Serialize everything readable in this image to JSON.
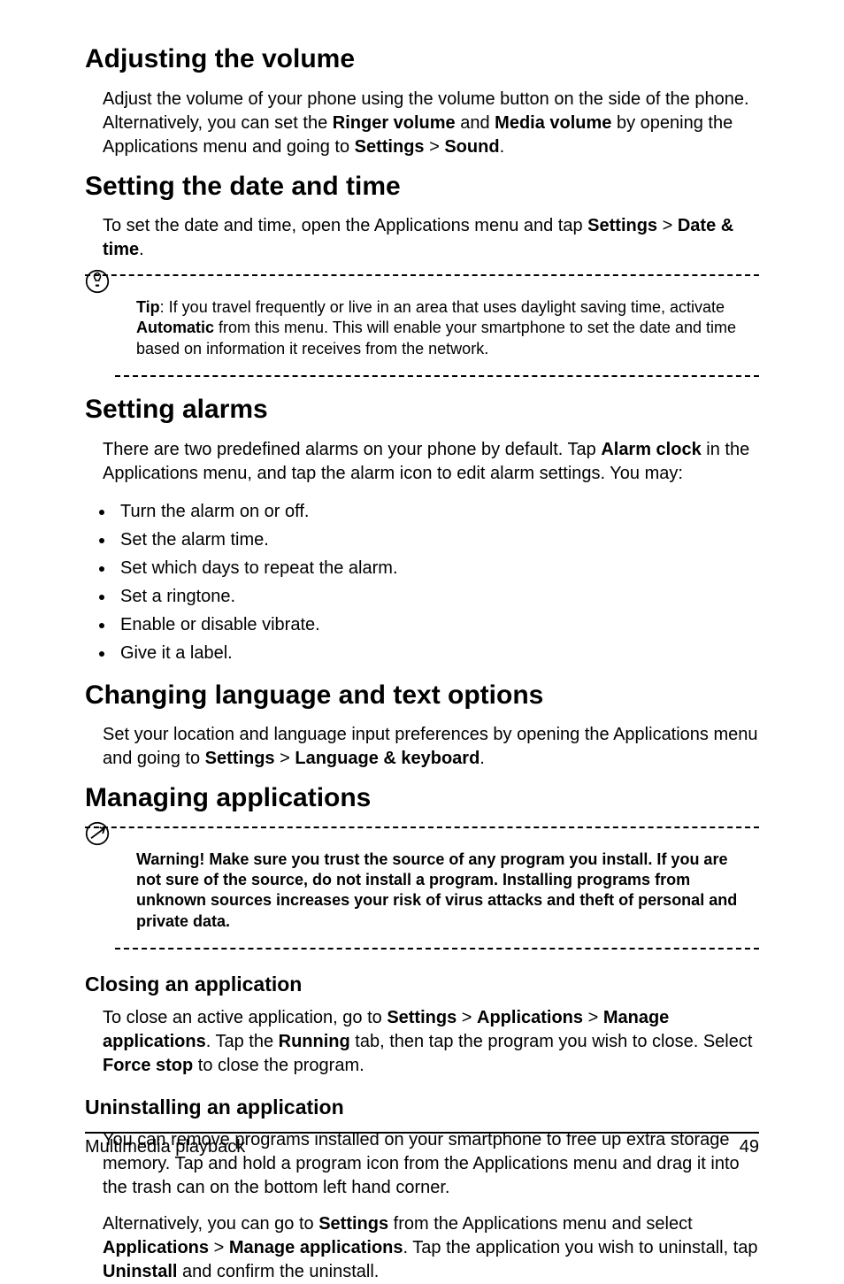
{
  "s1": {
    "h": "Adjusting the volume",
    "p_parts": [
      "Adjust the volume of your phone using the volume button on the side of the phone. Alternatively, you can set the ",
      "Ringer volume",
      " and ",
      "Media volume",
      " by opening the Applications menu and going to ",
      "Settings",
      " > ",
      "Sound",
      "."
    ]
  },
  "s2": {
    "h": "Setting the date and time",
    "p_parts": [
      "To set the date and time, open the Applications menu and tap ",
      "Settings",
      " > ",
      "Date & time",
      "."
    ],
    "tip_parts": [
      "Tip",
      ": If you travel frequently or live in an area that uses daylight saving time, activate ",
      "Automatic",
      " from this menu. This will enable your smartphone to set the date and time based on information it receives from the network."
    ]
  },
  "s3": {
    "h": "Setting alarms",
    "p_parts": [
      "There are two predefined alarms on your phone by default. Tap ",
      "Alarm clock",
      " in the Applications menu, and tap the alarm icon to edit alarm settings. You may:"
    ],
    "bullets": [
      "Turn the alarm on or off.",
      "Set the alarm time.",
      "Set which days to repeat the alarm.",
      "Set a ringtone.",
      "Enable or disable vibrate.",
      "Give it a label."
    ]
  },
  "s4": {
    "h": "Changing language and text options",
    "p_parts": [
      "Set your location and language input preferences by opening the Applications menu and going to ",
      "Settings",
      " > ",
      "Language & keyboard",
      "."
    ]
  },
  "s5": {
    "h": "Managing applications",
    "warn": "Warning! Make sure you trust the source of any program you install. If you are not sure of the source, do not install a program. Installing programs from unknown sources increases your risk of virus attacks and theft of personal and private data."
  },
  "s6": {
    "h": "Closing an application",
    "p_parts": [
      "To close an active application, go to ",
      "Settings",
      " > ",
      "Applications",
      " > ",
      "Manage applications",
      ". Tap the ",
      "Running",
      " tab, then tap the program you wish to close. Select ",
      "Force stop",
      " to close the program."
    ]
  },
  "s7": {
    "h": "Uninstalling an application",
    "p1": "You can remove programs installed on your smartphone to free up extra storage memory. Tap and hold a program icon from the Applications menu and drag it into the trash can on the bottom left hand corner.",
    "p2_parts": [
      "Alternatively, you can go to ",
      "Settings",
      " from the Applications menu and select ",
      "Applications",
      " > ",
      "Manage applications",
      ". Tap the application you wish to uninstall, tap ",
      "Uninstall",
      " and confirm the uninstall."
    ]
  },
  "footer": {
    "title": "Multimedia playback",
    "page_num": "49"
  }
}
